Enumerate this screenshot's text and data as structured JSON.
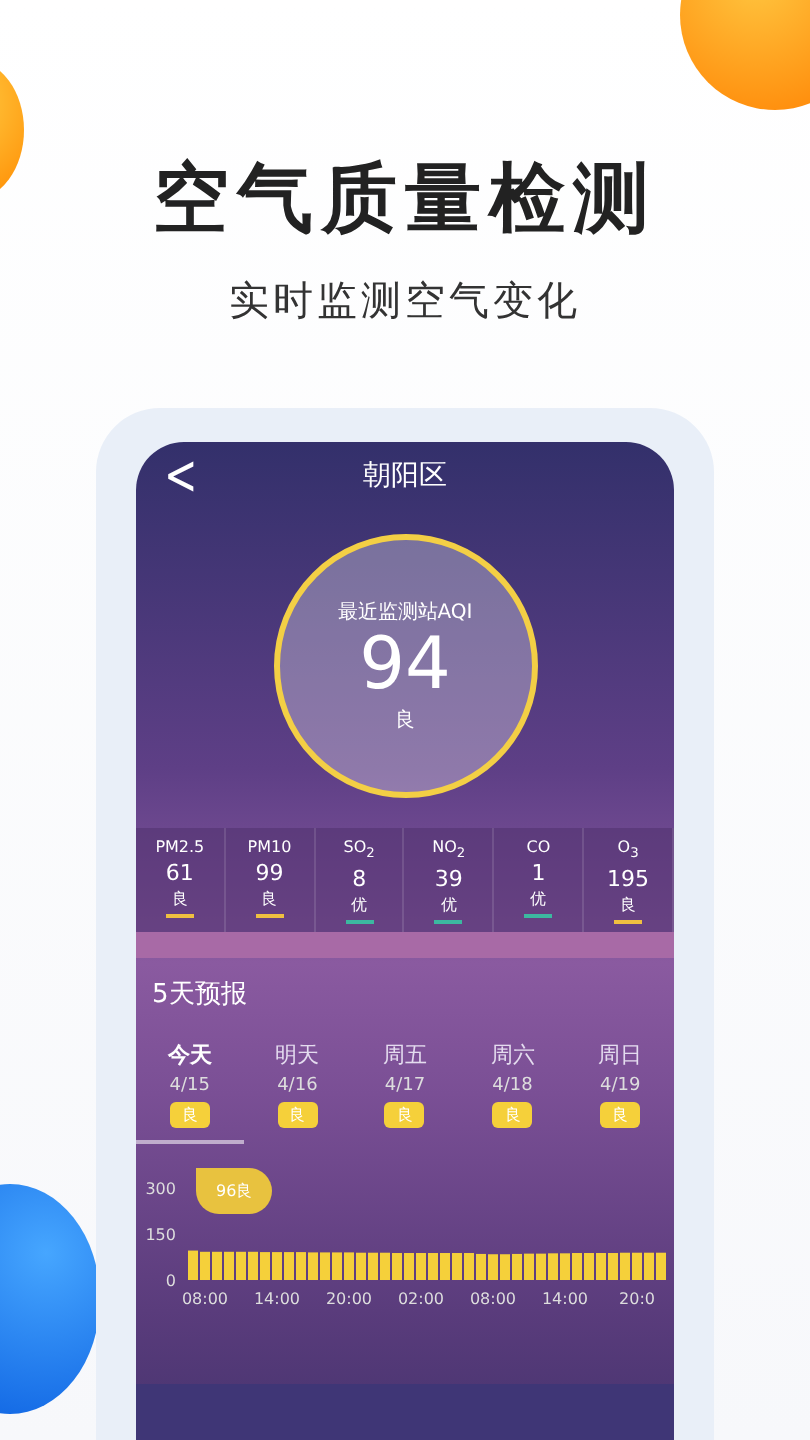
{
  "headline": "空气质量检测",
  "subtitle": "实时监测空气变化",
  "screen": {
    "back": "<",
    "title": "朝阳区",
    "aqi": {
      "label": "最近监测站AQI",
      "value": "94",
      "grade": "良"
    },
    "pollutants": [
      {
        "name": "PM2.5",
        "value": "61",
        "grade": "良",
        "color": "#f0c040"
      },
      {
        "name": "PM10",
        "value": "99",
        "grade": "良",
        "color": "#f0c040"
      },
      {
        "name": "SO$_{2}$",
        "value": "8",
        "grade": "优",
        "color": "#3cb8a0"
      },
      {
        "name": "NO$_{2}$",
        "value": "39",
        "grade": "优",
        "color": "#3cb8a0"
      },
      {
        "name": "CO",
        "value": "1",
        "grade": "优",
        "color": "#3cb8a0"
      },
      {
        "name": "O$_{3}$",
        "value": "195",
        "grade": "良",
        "color": "#f0c040"
      }
    ],
    "forecast_title": "5天预报",
    "forecast": [
      {
        "day": "今天",
        "date": "4/15",
        "grade": "良",
        "selected": true
      },
      {
        "day": "明天",
        "date": "4/16",
        "grade": "良",
        "selected": false
      },
      {
        "day": "周五",
        "date": "4/17",
        "grade": "良",
        "selected": false
      },
      {
        "day": "周六",
        "date": "4/18",
        "grade": "良",
        "selected": false
      },
      {
        "day": "周日",
        "date": "4/19",
        "grade": "良",
        "selected": false
      }
    ],
    "tooltip": "96良",
    "chart_data": {
      "type": "bar",
      "ylim": [
        0,
        300
      ],
      "yticks": [
        0,
        150,
        300
      ],
      "categories": [
        null,
        "08:00",
        null,
        null,
        null,
        null,
        null,
        "14:00",
        null,
        null,
        null,
        null,
        null,
        "20:00",
        null,
        null,
        null,
        null,
        null,
        "02:00",
        null,
        null,
        null,
        null,
        null,
        "08:00",
        null,
        null,
        null,
        null,
        null,
        "14:00",
        null,
        null,
        null,
        null,
        null,
        "20:0",
        null,
        null
      ],
      "values": [
        96,
        92,
        92,
        92,
        92,
        92,
        91,
        91,
        91,
        91,
        90,
        90,
        90,
        90,
        89,
        89,
        89,
        88,
        88,
        88,
        88,
        88,
        88,
        88,
        85,
        84,
        84,
        85,
        86,
        86,
        87,
        87,
        88,
        88,
        88,
        88,
        89,
        89,
        89,
        89
      ]
    }
  }
}
